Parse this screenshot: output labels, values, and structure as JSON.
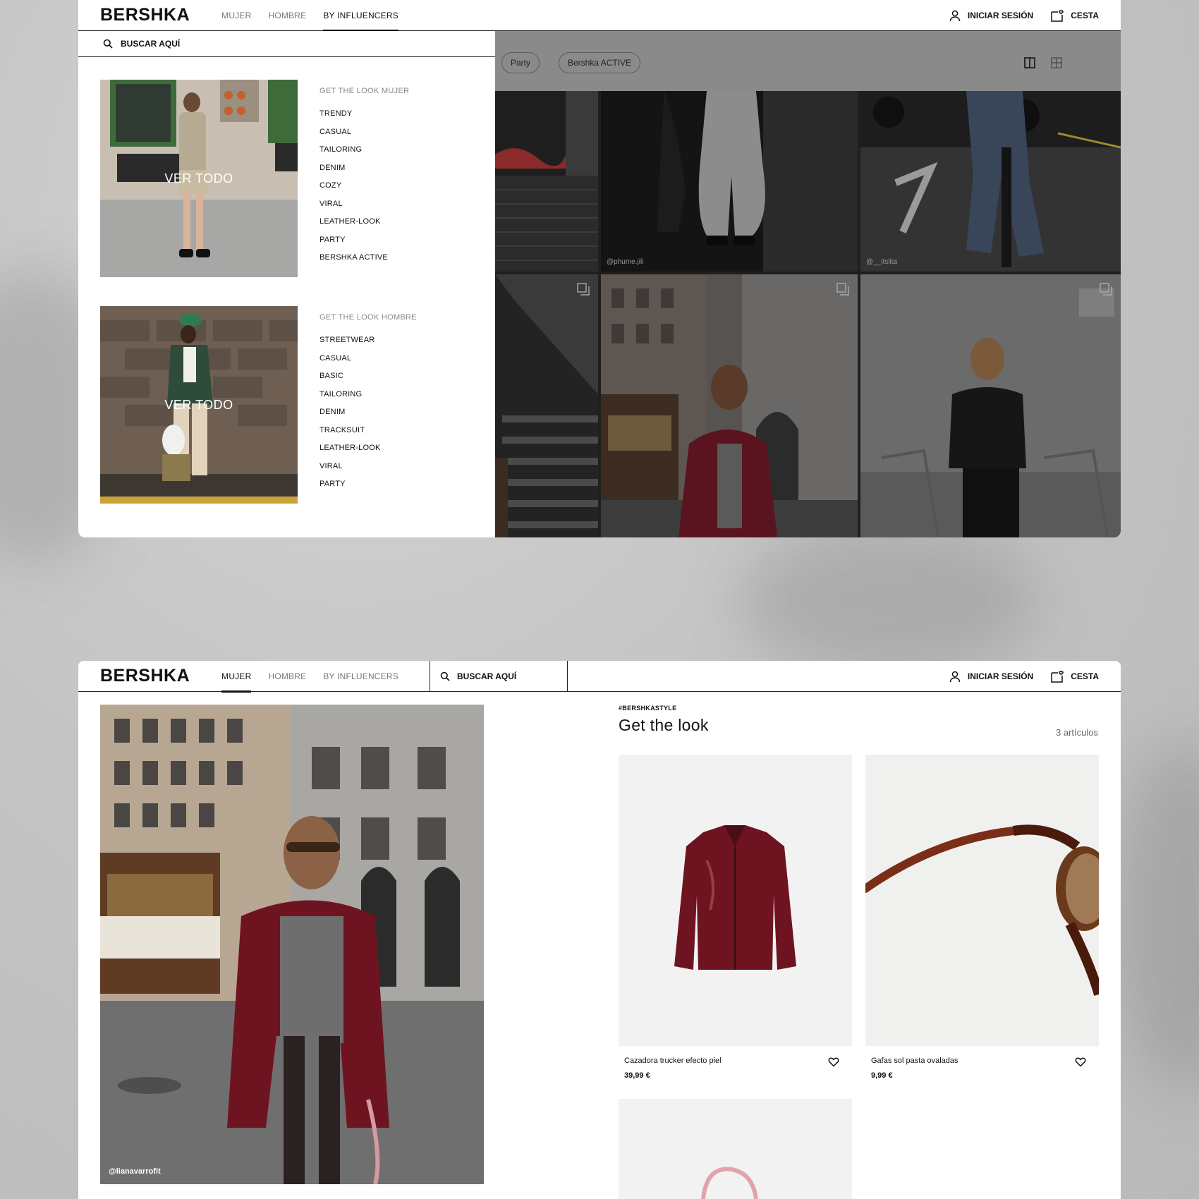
{
  "brand": {
    "logo": "BERSHKA"
  },
  "nav": {
    "mujer": "MUJER",
    "hombre": "HOMBRE",
    "influencers": "BY INFLUENCERS"
  },
  "actions": {
    "login": "INICIAR SESIÓN",
    "cart": "CESTA"
  },
  "search": {
    "label": "BUSCAR AQUÍ"
  },
  "menu": {
    "women": {
      "heading": "GET THE LOOK MUJER",
      "view_all": "VER TODO",
      "items": [
        "TRENDY",
        "CASUAL",
        "TAILORING",
        "DENIM",
        "COZY",
        "VIRAL",
        "LEATHER-LOOK",
        "PARTY",
        "BERSHKA ACTIVE"
      ]
    },
    "men": {
      "heading": "GET THE LOOK HOMBRE",
      "view_all": "VER TODO",
      "items": [
        "STREETWEAR",
        "CASUAL",
        "BASIC",
        "TAILORING",
        "DENIM",
        "TRACKSUIT",
        "LEATHER-LOOK",
        "VIRAL",
        "PARTY"
      ]
    }
  },
  "filters": {
    "chips": [
      "Party",
      "Bershka ACTIVE"
    ]
  },
  "grid": {
    "handles": [
      "@phume.jili",
      "@__itslita"
    ]
  },
  "detail": {
    "hero_handle": "@lianavarrofit",
    "hashtag": "#BERSHKASTYLE",
    "title": "Get the look",
    "count": "3 artículos",
    "products": [
      {
        "name": "Cazadora trucker efecto piel",
        "price": "39,99 €"
      },
      {
        "name": "Gafas sol pasta ovaladas",
        "price": "9,99 €"
      }
    ]
  },
  "colors": {
    "accent": "#111111",
    "jacket": "#6e1420",
    "overlay": "#1f1f1f"
  }
}
